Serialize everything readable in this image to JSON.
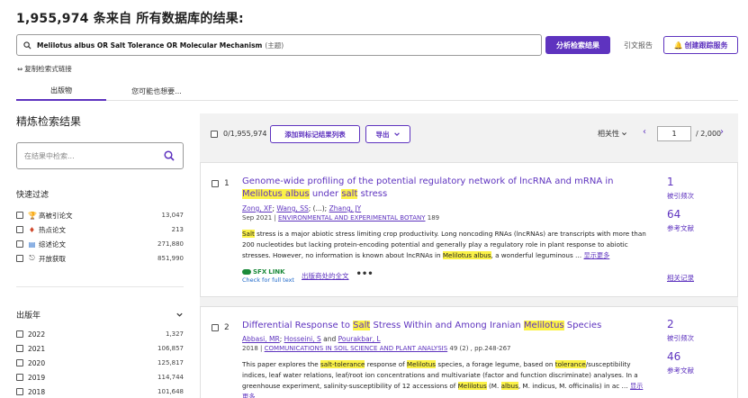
{
  "header": {
    "title": "1,955,974 条来自 所有数据库的结果:",
    "query": "Melilotus albus OR Salt Tolerance OR Molecular Mechanism",
    "query_field": "(主题)",
    "analyze_button": "分析检索结果",
    "citation_report": "引文报告",
    "create_alert": "创建跟踪服务",
    "copy_link": "复制检索式链接"
  },
  "tabs": [
    {
      "label": "出版物"
    },
    {
      "label": "您可能也想要..."
    }
  ],
  "sidebar": {
    "title": "精炼检索结果",
    "search_placeholder": "在结果中检索...",
    "quick_filter_title": "快速过滤",
    "quick_filters": [
      {
        "label": "高被引论文",
        "count": "13,047",
        "icon": "trophy-icon"
      },
      {
        "label": "热点论文",
        "count": "213",
        "icon": "flame-icon"
      },
      {
        "label": "综述论文",
        "count": "271,880",
        "icon": "document-icon"
      },
      {
        "label": "开放获取",
        "count": "851,990",
        "icon": "open-lock-icon"
      }
    ],
    "pub_year_title": "出版年",
    "years": [
      {
        "label": "2022",
        "count": "1,327"
      },
      {
        "label": "2021",
        "count": "106,857"
      },
      {
        "label": "2020",
        "count": "125,817"
      },
      {
        "label": "2019",
        "count": "114,744"
      },
      {
        "label": "2018",
        "count": "101,648"
      }
    ]
  },
  "toolbar": {
    "selected": "0/1,955,974",
    "add_marked": "添加到标记结果列表",
    "export": "导出",
    "sort": "相关性",
    "page": "1",
    "total_pages": "/ 2,000"
  },
  "results": [
    {
      "index": "1",
      "title_parts": [
        "Genome-wide profiling of the potential regulatory network of lncRNA and mRNA in ",
        "Melilotus albus",
        " under ",
        "salt",
        " stress"
      ],
      "authors": [
        "Zong, XF",
        "Wang, SS",
        "(...)",
        "Zhang, JY"
      ],
      "date": "Sep 2021",
      "journal": "ENVIRONMENTAL AND EXPERIMENTAL BOTANY",
      "journal_meta": "189",
      "abstract_parts": [
        "Salt",
        " stress is a major abiotic stress limiting crop productivity. Long noncoding RNAs (lncRNAs) are transcripts with more than 200 nucleotides but lacking protein-encoding potential and generally play a regulatory role in plant response to abiotic stresses. However, no information is known about lncRNAs in ",
        "Melilotus albus",
        ", a wonderful leguminous …"
      ],
      "show_more": "显示更多",
      "citations": "1",
      "citations_label": "被引频次",
      "references": "64",
      "references_label": "参考文献",
      "related": "相关记录",
      "sfx_line1": "LINK",
      "sfx_prefix": "SFX",
      "sfx_line2": "Check for full text",
      "publisher_text": "出版商处的全文"
    },
    {
      "index": "2",
      "title_parts": [
        "Differential Response to ",
        "Salt",
        " Stress Within and Among Iranian ",
        "Melilotus",
        " Species"
      ],
      "authors": [
        "Abbasi, MR",
        "Hosseini, S",
        "and",
        "Pourakbar, L"
      ],
      "date": "2018",
      "journal": "COMMUNICATIONS IN SOIL SCIENCE AND PLANT ANALYSIS",
      "journal_meta": "49 (2) , pp.248-267",
      "abstract_parts": [
        "This paper explores the ",
        "salt-tolerance",
        " response of ",
        "Melilotus",
        " species, a forage legume, based on ",
        "tolerance",
        "/susceptibility indices, leaf water relations, leaf/root ion concentrations and multivariate (factor and function discriminate) analyses. In a greenhouse experiment, salinity-susceptibility of 12 accessions of ",
        "Melilotus",
        " (M. ",
        "albus",
        ", M. indicus, M. officinalis) in ac …"
      ],
      "show_more": "显示更多",
      "citations": "2",
      "citations_label": "被引频次",
      "references": "46",
      "references_label": "参考文献"
    }
  ],
  "colors": {
    "accent": "#5e33bf",
    "highlight": "#fbf247"
  }
}
